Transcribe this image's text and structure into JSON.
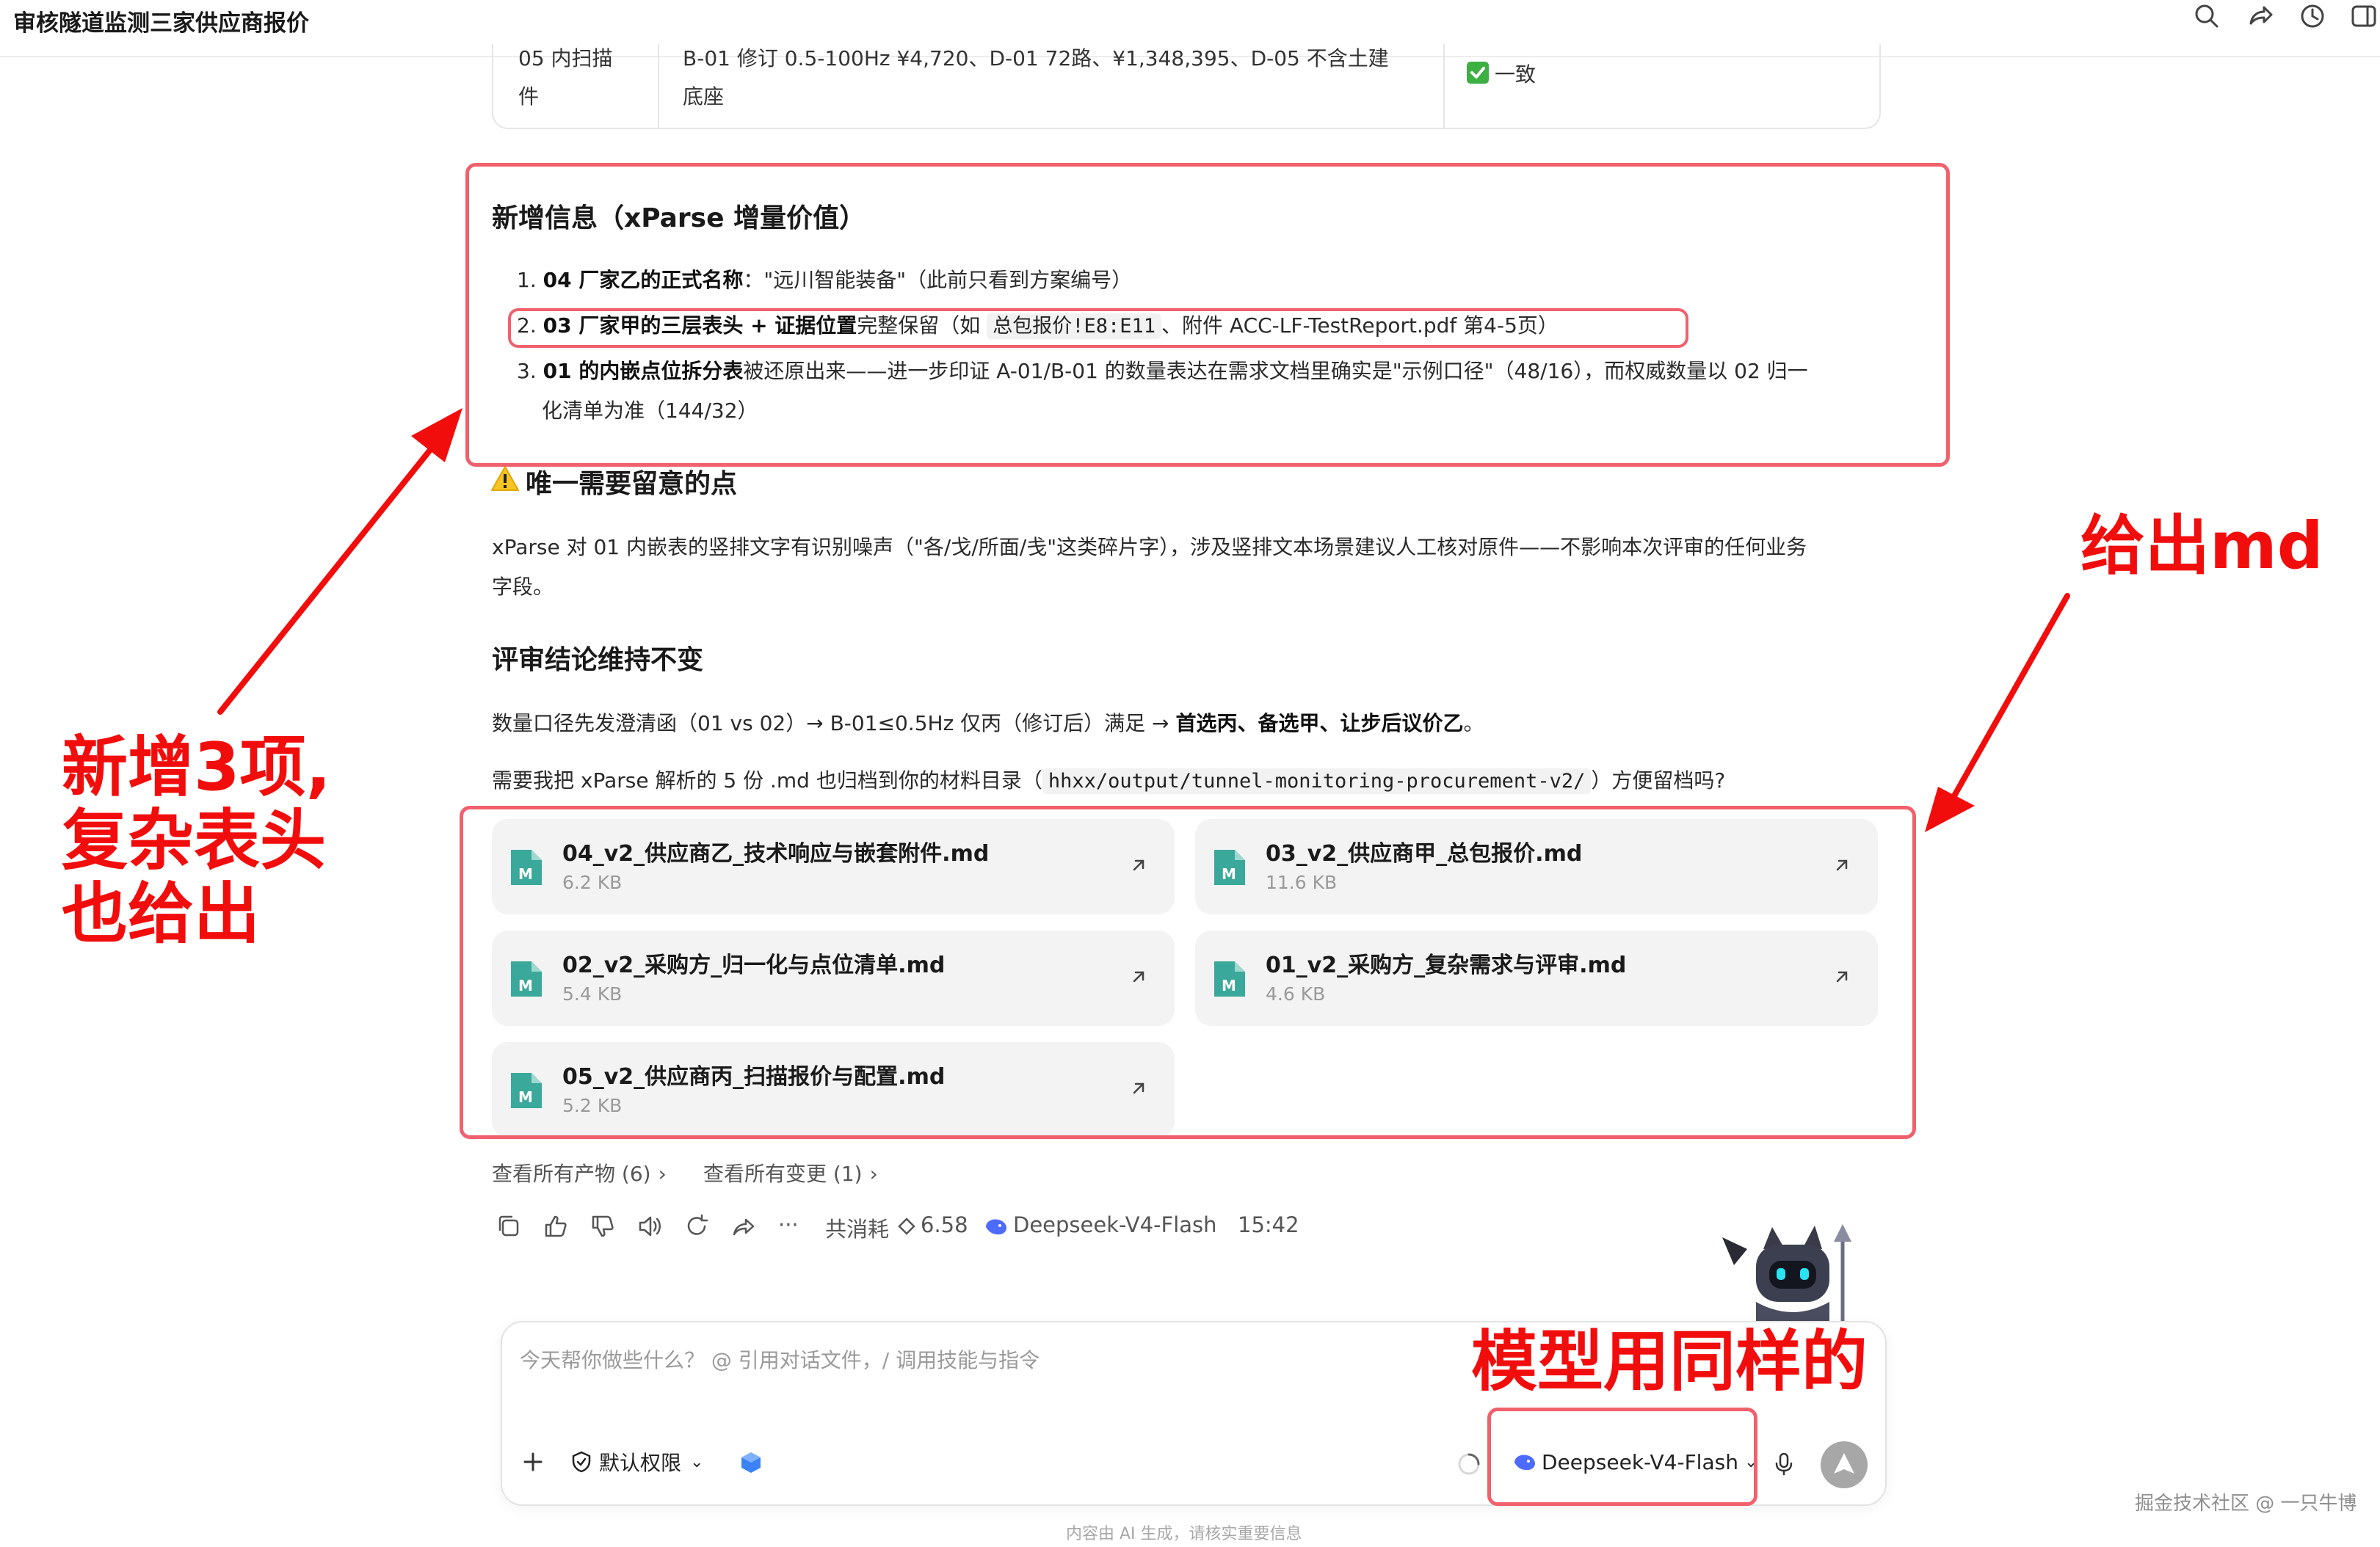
{
  "header": {
    "title": "审核隧道监测三家供应商报价"
  },
  "prev_table": {
    "col1": [
      "05 内扫描",
      "件"
    ],
    "col2": [
      "B-01 修订 0.5-100Hz ¥4,720、D-01 72路、¥1,348,395、D-05 不含土建",
      "底座"
    ],
    "col3": "一致"
  },
  "new_info": {
    "heading": "新增信息（xParse 增量价值）",
    "items": [
      {
        "num": "1.",
        "bold": "04 厂家乙的正式名称",
        "text": "：\"远川智能装备\"（此前只看到方案编号）"
      },
      {
        "num": "2.",
        "bold": "03 厂家甲的三层表头 + 证据位置",
        "text_a": "完整保留（如 ",
        "code": "总包报价!E8:E11",
        "text_b": "、附件 ACC-LF-TestReport.pdf 第4-5页）"
      },
      {
        "num": "3.",
        "bold": "01 的内嵌点位拆分表",
        "text": "被还原出来——进一步印证 A-01/B-01 的数量表达在需求文档里确实是\"示例口径\"（48/16），而权威数量以 02 归一",
        "text2": "化清单为准（144/32）"
      }
    ]
  },
  "notice": {
    "heading": "唯一需要留意的点",
    "line1": "xParse 对 01 内嵌表的竖排文字有识别噪声（\"各/戈/所面/戋\"这类碎片字），涉及竖排文本场景建议人工核对原件——不影响本次评审的任何业务",
    "line2": "字段。"
  },
  "conclusion": {
    "heading": "评审结论维持不变",
    "text_a": "数量口径先发澄清函（01 vs 02）→ B-01≤0.5Hz 仅丙（修订后）满足 → ",
    "bold": "首选丙、备选甲、让步后议价乙",
    "text_b": "。"
  },
  "archive": {
    "text_a": "需要我把 xParse 解析的 5 份 .md 也归档到你的材料目录（",
    "code": "hhxx/output/tunnel-monitoring-procurement-v2/",
    "text_b": "）方便留档吗?"
  },
  "files": [
    {
      "name": "04_v2_供应商乙_技术响应与嵌套附件.md",
      "size": "6.2 KB"
    },
    {
      "name": "03_v2_供应商甲_总包报价.md",
      "size": "11.6 KB"
    },
    {
      "name": "02_v2_采购方_归一化与点位清单.md",
      "size": "5.4 KB"
    },
    {
      "name": "01_v2_采购方_复杂需求与评审.md",
      "size": "4.6 KB"
    },
    {
      "name": "05_v2_供应商丙_扫描报价与配置.md",
      "size": "5.2 KB"
    }
  ],
  "links": {
    "artifacts": "查看所有产物 (6)",
    "changes": "查看所有变更 (1)"
  },
  "meta": {
    "cost_label": "共消耗",
    "cost_value": "6.58",
    "model": "Deepseek-V4-Flash",
    "time": "15:42",
    "more": "···"
  },
  "input": {
    "placeholder": "今天帮你做些什么？ @ 引用对话文件，/ 调用技能与指令",
    "permission": "默认权限",
    "model": "Deepseek-V4-Flash"
  },
  "footer_note": "内容由 AI 生成，请核实重要信息",
  "watermark": "掘金技术社区 @ 一只牛博",
  "annotations": {
    "left_1": "新增3项,",
    "left_2": "复杂表头",
    "left_3": "也给出",
    "right": "给出md",
    "bottom": "模型用同样的"
  },
  "colors": {
    "annotation_red": "#f20d0d",
    "box_red": "#f0616d",
    "md_badge": "#3aa89a"
  }
}
